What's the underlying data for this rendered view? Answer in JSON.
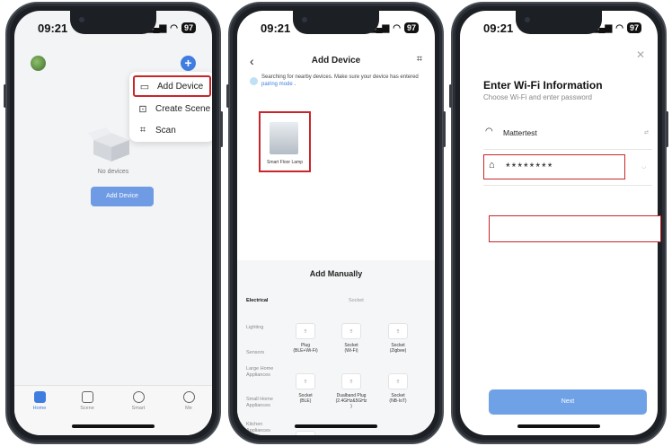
{
  "colors": {
    "accent": "#3f7de0",
    "highlight": "#c8262a",
    "button_light": "#6e9be3"
  },
  "phone1": {
    "time": "09:21",
    "battery": "97",
    "menu": {
      "add_device": "Add Device",
      "create_scene": "Create Scene",
      "scan": "Scan"
    },
    "no_devices": "No devices",
    "add_device_button": "Add Device",
    "tabs": [
      "Home",
      "Scene",
      "Smart",
      "Me"
    ]
  },
  "phone2": {
    "time": "09:21",
    "battery": "97",
    "title": "Add Device",
    "searching_text": "Searching for nearby devices. Make sure your device has entered",
    "pairing_link": "pairing mode",
    "pairing_suffix": ".",
    "found_device": "Smart Floor Lamp",
    "add_manually": "Add Manually",
    "categories": [
      "Electrical",
      "Lighting",
      "Sensors",
      "Large Home Appliances",
      "Small Home Appliances",
      "Kitchen Appliances"
    ],
    "section_title": "Socket",
    "devices": [
      {
        "name": "Plug",
        "sub": "(BLE+Wi-Fi)"
      },
      {
        "name": "Socket",
        "sub": "(Wi-Fi)"
      },
      {
        "name": "Socket",
        "sub": "(Zigbee)"
      },
      {
        "name": "Socket",
        "sub": "(BLE)"
      },
      {
        "name": "Dualband Plug",
        "sub": "(2.4GHz&5GHz",
        "sub2": ")"
      },
      {
        "name": "Socket",
        "sub": "(NB-IoT)"
      }
    ]
  },
  "phone3": {
    "time": "09:21",
    "battery": "97",
    "title": "Enter Wi-Fi Information",
    "subtitle": "Choose Wi-Fi and enter password",
    "ssid": "Mattertest",
    "password": "********",
    "next_button": "Next"
  }
}
